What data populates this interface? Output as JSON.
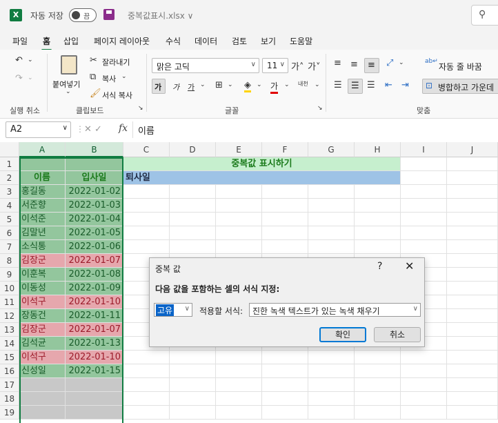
{
  "titlebar": {
    "autosave_label": "자동 저장",
    "toggle_state": "끔",
    "filename": "중복값표시.xlsx ∨"
  },
  "menu": [
    "파일",
    "홈",
    "삽입",
    "페이지 레이아웃",
    "수식",
    "데이터",
    "검토",
    "보기",
    "도움말"
  ],
  "menu_active": "홈",
  "ribbon": {
    "undo_group": "실행 취소",
    "paste": "붙여넣기",
    "cut": "잘라내기",
    "copy": "복사",
    "format_painter": "서식 복사",
    "clipboard_group": "클립보드",
    "font_name": "맑은 고딕",
    "font_size": "11",
    "font_group": "글꼴",
    "wrap_text": "자동 줄 바꿈",
    "merge_center": "병합하고 가운데",
    "align_group": "맞춤"
  },
  "formula_bar": {
    "cell_ref": "A2",
    "fx": "fx",
    "value": "이름"
  },
  "columns": [
    "A",
    "B",
    "C",
    "D",
    "E",
    "F",
    "G",
    "H",
    "I",
    "J"
  ],
  "rows": [
    "1",
    "2",
    "3",
    "4",
    "5",
    "6",
    "7",
    "8",
    "9",
    "10",
    "11",
    "12",
    "13",
    "14",
    "15",
    "16",
    "17",
    "18",
    "19"
  ],
  "sheet": {
    "title": "중복값 표시하기",
    "subtitle": "퇴사일",
    "header_name": "이름",
    "header_date": "입사일",
    "records": [
      {
        "name": "홍길동",
        "date": "2022-01-02",
        "dup": false
      },
      {
        "name": "서준향",
        "date": "2022-01-03",
        "dup": false
      },
      {
        "name": "이석준",
        "date": "2022-01-04",
        "dup": false
      },
      {
        "name": "김말년",
        "date": "2022-01-05",
        "dup": false
      },
      {
        "name": "소식통",
        "date": "2022-01-06",
        "dup": false
      },
      {
        "name": "김장군",
        "date": "2022-01-07",
        "dup": true
      },
      {
        "name": "이훈복",
        "date": "2022-01-08",
        "dup": false
      },
      {
        "name": "이동성",
        "date": "2022-01-09",
        "dup": false
      },
      {
        "name": "이석구",
        "date": "2022-01-10",
        "dup": true
      },
      {
        "name": "장동건",
        "date": "2022-01-11",
        "dup": false
      },
      {
        "name": "김장군",
        "date": "2022-01-07",
        "dup": true
      },
      {
        "name": "김석균",
        "date": "2022-01-13",
        "dup": false
      },
      {
        "name": "이석구",
        "date": "2022-01-10",
        "dup": true
      },
      {
        "name": "신성일",
        "date": "2022-01-15",
        "dup": false
      }
    ]
  },
  "colors": {
    "unique_fill": "#93c69d",
    "dup_fill": "#e6a7ad",
    "unique_text": "#1a5c2a",
    "dup_text": "#9c1b2a",
    "header_text": "#1b7a1b",
    "title_fill": "#c6efce",
    "title_text": "#1b7a1b",
    "subtitle_fill": "#9ec3e6",
    "selection_fill": "#c8c8c8"
  },
  "dialog": {
    "title": "중복 값",
    "help": "?",
    "close": "✕",
    "prompt": "다음 값을 포함하는 셀의 서식 지정:",
    "type_value": "고유",
    "format_label": "적용할 서식:",
    "format_value": "진한 녹색 텍스트가 있는 녹색 채우기",
    "ok": "확인",
    "cancel": "취소"
  }
}
